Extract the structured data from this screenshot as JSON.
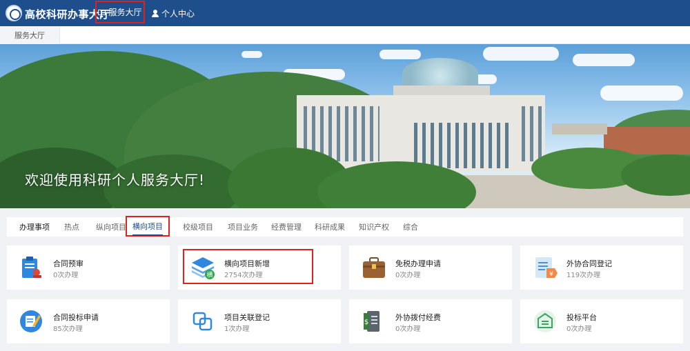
{
  "header": {
    "app_title": "高校科研办事大厅",
    "nav": {
      "service_hall": "服务大厅",
      "personal_center": "个人中心"
    }
  },
  "tab_strip": {
    "active_tab": "服务大厅"
  },
  "banner": {
    "welcome_text": "欢迎使用科研个人服务大厅!"
  },
  "categories": [
    "办理事项",
    "热点",
    "纵向项目",
    "横向项目",
    "校级项目",
    "项目业务",
    "经费管理",
    "科研成果",
    "知识产权",
    "综合"
  ],
  "active_category": "横向项目",
  "services": [
    {
      "name": "合同预审",
      "count": "0次办理",
      "icon": "clipboard-stamp-icon"
    },
    {
      "name": "横向项目新增",
      "count": "2754次办理",
      "icon": "layers-stack-icon",
      "badge": "横"
    },
    {
      "name": "免税办理申请",
      "count": "0次办理",
      "icon": "briefcase-icon"
    },
    {
      "name": "外协合同登记",
      "count": "119次办理",
      "icon": "document-yen-icon"
    },
    {
      "name": "合同投标申请",
      "count": "85次办理",
      "icon": "notepad-pencil-icon"
    },
    {
      "name": "项目关联登记",
      "count": "1次办理",
      "icon": "linked-squares-icon"
    },
    {
      "name": "外协拨付经费",
      "count": "0次办理",
      "icon": "dollar-document-icon"
    },
    {
      "name": "投标平台",
      "count": "0次办理",
      "icon": "bid-platform-icon"
    }
  ],
  "colors": {
    "header_bg": "#1f4e8c",
    "highlight_red": "#e0221b",
    "accent_blue": "#2f87e0"
  }
}
